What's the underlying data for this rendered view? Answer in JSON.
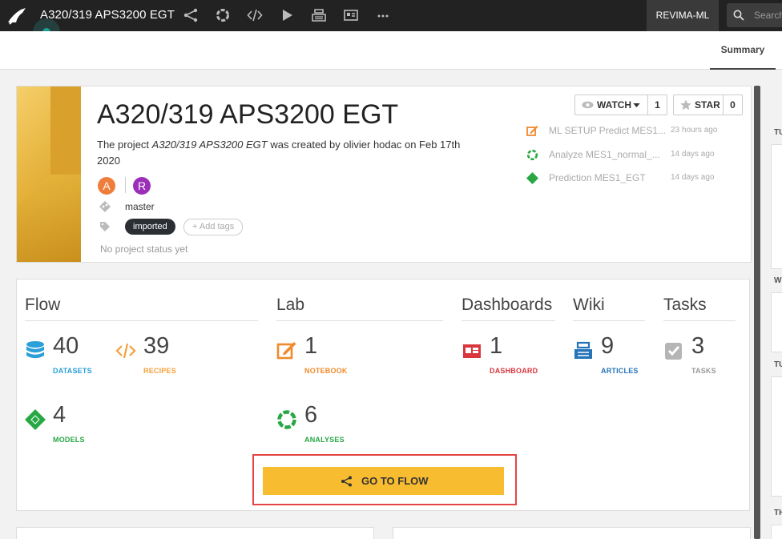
{
  "topbar": {
    "project_title": "A320/319 APS3200 EGT",
    "project_key": "REVIMA-ML",
    "search_placeholder": "Search"
  },
  "subheader": {
    "tab_summary": "Summary"
  },
  "project": {
    "name": "A320/319 APS3200 EGT",
    "desc_prefix": "The project ",
    "desc_project": "A320/319 APS3200 EGT",
    "desc_suffix": " was created by olivier hodac on Feb 17th 2020",
    "avatars": [
      {
        "letter": "A",
        "color": "#ef7d3c"
      },
      {
        "letter": "R",
        "color": "#9c2fb8"
      }
    ],
    "branch": "master",
    "tag": "imported",
    "add_tags": "+ Add tags",
    "status": "No project status yet"
  },
  "actions": {
    "watch_label": "WATCH",
    "watch_count": "1",
    "star_label": "STAR",
    "star_count": "0"
  },
  "activity": [
    {
      "name": "ML SETUP Predict MES1...",
      "time": "23 hours ago",
      "icon": "notebook-icon"
    },
    {
      "name": "Analyze MES1_normal_...",
      "time": "14 days ago",
      "icon": "analysis-icon"
    },
    {
      "name": "Prediction MES1_EGT",
      "time": "14 days ago",
      "icon": "model-icon"
    }
  ],
  "sections": {
    "flow": "Flow",
    "lab": "Lab",
    "dashboards": "Dashboards",
    "wiki": "Wiki",
    "tasks": "Tasks"
  },
  "stats": {
    "datasets": {
      "count": "40",
      "label": "DATASETS",
      "color": "#2a9fd8"
    },
    "recipes": {
      "count": "39",
      "label": "RECIPES",
      "color": "#f3a13b"
    },
    "models": {
      "count": "4",
      "label": "MODELS",
      "color": "#28a745"
    },
    "notebook": {
      "count": "1",
      "label": "NOTEBOOK",
      "color": "#f08a2c"
    },
    "analyses": {
      "count": "6",
      "label": "ANALYSES",
      "color": "#28a745"
    },
    "dashboard": {
      "count": "1",
      "label": "DASHBOARD",
      "color": "#d9363e"
    },
    "articles": {
      "count": "9",
      "label": "ARTICLES",
      "color": "#2673b8"
    },
    "tasks": {
      "count": "3",
      "label": "TASKS",
      "color": "#999999"
    }
  },
  "go_to_flow": "GO TO FLOW",
  "right_col_labels": [
    "TU",
    "W",
    "TU",
    "TH"
  ]
}
